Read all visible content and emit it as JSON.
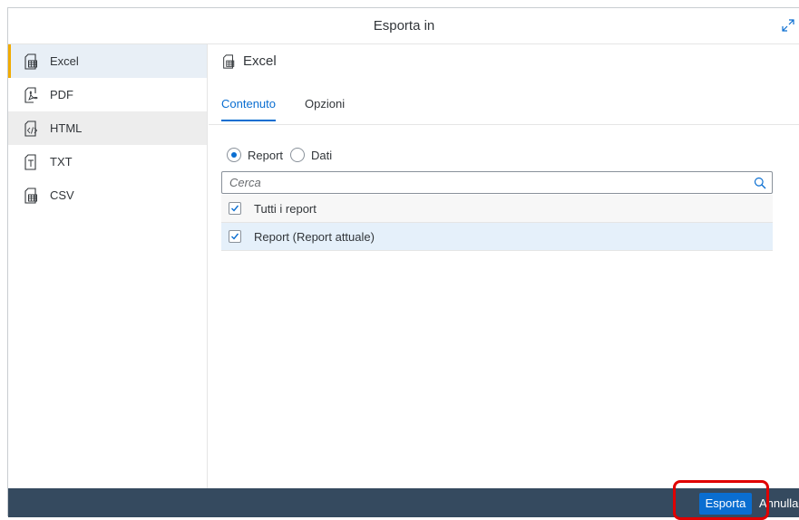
{
  "dialog": {
    "title": "Esporta in"
  },
  "sidebar": {
    "items": [
      {
        "label": "Excel",
        "icon": "excel-icon"
      },
      {
        "label": "PDF",
        "icon": "pdf-icon"
      },
      {
        "label": "HTML",
        "icon": "html-icon"
      },
      {
        "label": "TXT",
        "icon": "txt-icon"
      },
      {
        "label": "CSV",
        "icon": "csv-icon"
      }
    ],
    "selected": "Excel"
  },
  "main": {
    "title": "Excel",
    "tabs": [
      {
        "label": "Contenuto",
        "active": true
      },
      {
        "label": "Opzioni",
        "active": false
      }
    ],
    "radio": {
      "options": [
        "Report",
        "Dati"
      ],
      "selected": "Report"
    },
    "search": {
      "placeholder": "Cerca",
      "value": ""
    },
    "list": [
      {
        "label": "Tutti i report",
        "checked": true
      },
      {
        "label": "Report (Report attuale)",
        "checked": true
      }
    ]
  },
  "footer": {
    "export_label": "Esporta",
    "cancel_label": "Annulla"
  },
  "colors": {
    "accent": "#0a6ed1",
    "footer_bg": "#354a5f",
    "selected_marker": "#f0ab00",
    "highlight": "#e00000"
  }
}
